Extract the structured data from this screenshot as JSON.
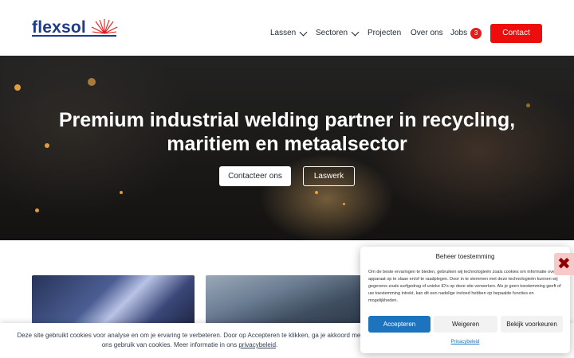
{
  "header": {
    "logo_text": "flexsol",
    "nav": [
      {
        "label": "Lassen",
        "dropdown": true
      },
      {
        "label": "Sectoren",
        "dropdown": true
      },
      {
        "label": "Projecten",
        "dropdown": false
      },
      {
        "label": "Over ons",
        "dropdown": false
      },
      {
        "label": "Jobs",
        "dropdown": false,
        "badge": "3"
      }
    ],
    "contact_button": "Contact"
  },
  "hero": {
    "title_line1": "Premium industrial welding partner in recycling,",
    "title_line2": "maritiem en metaalsector",
    "primary_button": "Contacteer ons",
    "secondary_button": "Laswerk"
  },
  "cookie_bar": {
    "text": "Deze site gebruikt cookies voor analyse en om je ervaring te verbeteren. Door op Accepteren te klikken, ga je akkoord met ons gebruik van cookies. Meer informatie in",
    "text_suffix": "ons",
    "link": "privacybeleid"
  },
  "consent_modal": {
    "title": "Beheer toestemming",
    "body": "Om de beste ervaringen te bieden, gebruiken wij technologieën zoals cookies om informatie over je apparaat op te slaan en/of te raadplegen. Door in te stemmen met deze technologieën kunnen wij gegevens zoals surfgedrag of unieke ID's op deze site verwerken. Als je geen toestemming geeft of uw toestemming intrekt, kan dit een nadelige invloed hebben op bepaalde functies en mogelijkheden.",
    "accept_button": "Accepteren",
    "deny_button": "Weigeren",
    "preferences_button": "Bekijk voorkeuren",
    "privacy_link": "Privacybeleid"
  },
  "colors": {
    "brand_blue": "#1e3a8a",
    "accent_red": "#ee0d0d",
    "accept_blue": "#1e73be"
  },
  "icons": [
    "chevron-down-icon",
    "close-icon",
    "spark-logo-icon"
  ]
}
